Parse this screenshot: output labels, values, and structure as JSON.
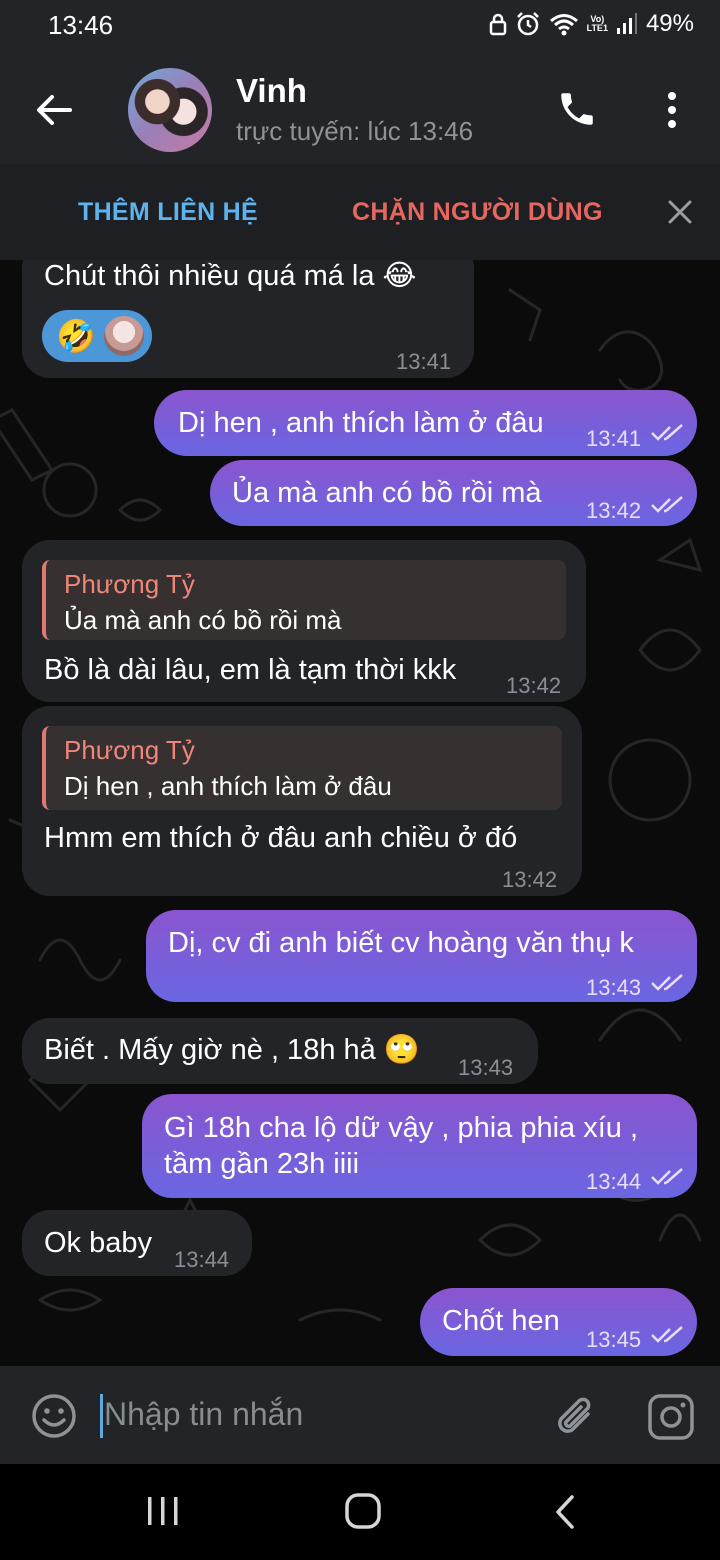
{
  "status_bar": {
    "time": "13:46",
    "battery": "49%",
    "network": "LTE1",
    "icons": [
      "lock-icon",
      "alarm-icon",
      "wifi-icon",
      "volte-icon",
      "signal-icon"
    ]
  },
  "header": {
    "contact_name": "Vinh",
    "status": "trực tuyến: lúc 13:46",
    "icons": [
      "back-arrow-icon",
      "phone-icon",
      "more-vertical-icon"
    ]
  },
  "action_bar": {
    "add_contact": "THÊM LIÊN HỆ",
    "block_user": "CHẶN NGƯỜI DÙNG"
  },
  "messages": [
    {
      "dir": "in",
      "text": "Chút thôi nhiều quá má la 😂",
      "time": "13:41",
      "reactions": [
        "🤣",
        "avatar"
      ]
    },
    {
      "dir": "out",
      "text": "Dị hen , anh thích làm ở đâu",
      "time": "13:41",
      "read": true
    },
    {
      "dir": "out",
      "text": "Ủa mà anh có bồ rồi mà",
      "time": "13:42",
      "read": true
    },
    {
      "dir": "in",
      "quote_name": "Phương Tỷ",
      "quote_text": "Ủa mà anh có bồ rồi mà",
      "text": "Bồ là dài lâu, em là tạm thời kkk",
      "time": "13:42"
    },
    {
      "dir": "in",
      "quote_name": "Phương Tỷ",
      "quote_text": "Dị hen , anh thích làm ở đâu",
      "text": "Hmm em thích ở đâu anh chiều ở đó",
      "time": "13:42"
    },
    {
      "dir": "out",
      "text": "Dị, cv đi anh biết cv hoàng văn thụ k",
      "time": "13:43",
      "read": true
    },
    {
      "dir": "in",
      "text": "Biết . Mấy giờ nè , 18h hả 🙄",
      "time": "13:43"
    },
    {
      "dir": "out",
      "text_line1": "Gì 18h cha lộ dữ vậy , phia phia xíu ,",
      "text_line2": "tầm gần 23h iiii",
      "time": "13:44",
      "read": true
    },
    {
      "dir": "in",
      "text": "Ok baby",
      "time": "13:44"
    },
    {
      "dir": "out",
      "text": "Chốt hen",
      "time": "13:45",
      "read": true
    }
  ],
  "input": {
    "placeholder": "Nhập tin nhắn"
  },
  "colors": {
    "out_gradient_top": "#7d5bd3",
    "out_gradient_bottom": "#6e63e0",
    "incoming_bubble": "#232427",
    "link_blue": "#5fb3ec",
    "danger_red": "#e5675f"
  }
}
